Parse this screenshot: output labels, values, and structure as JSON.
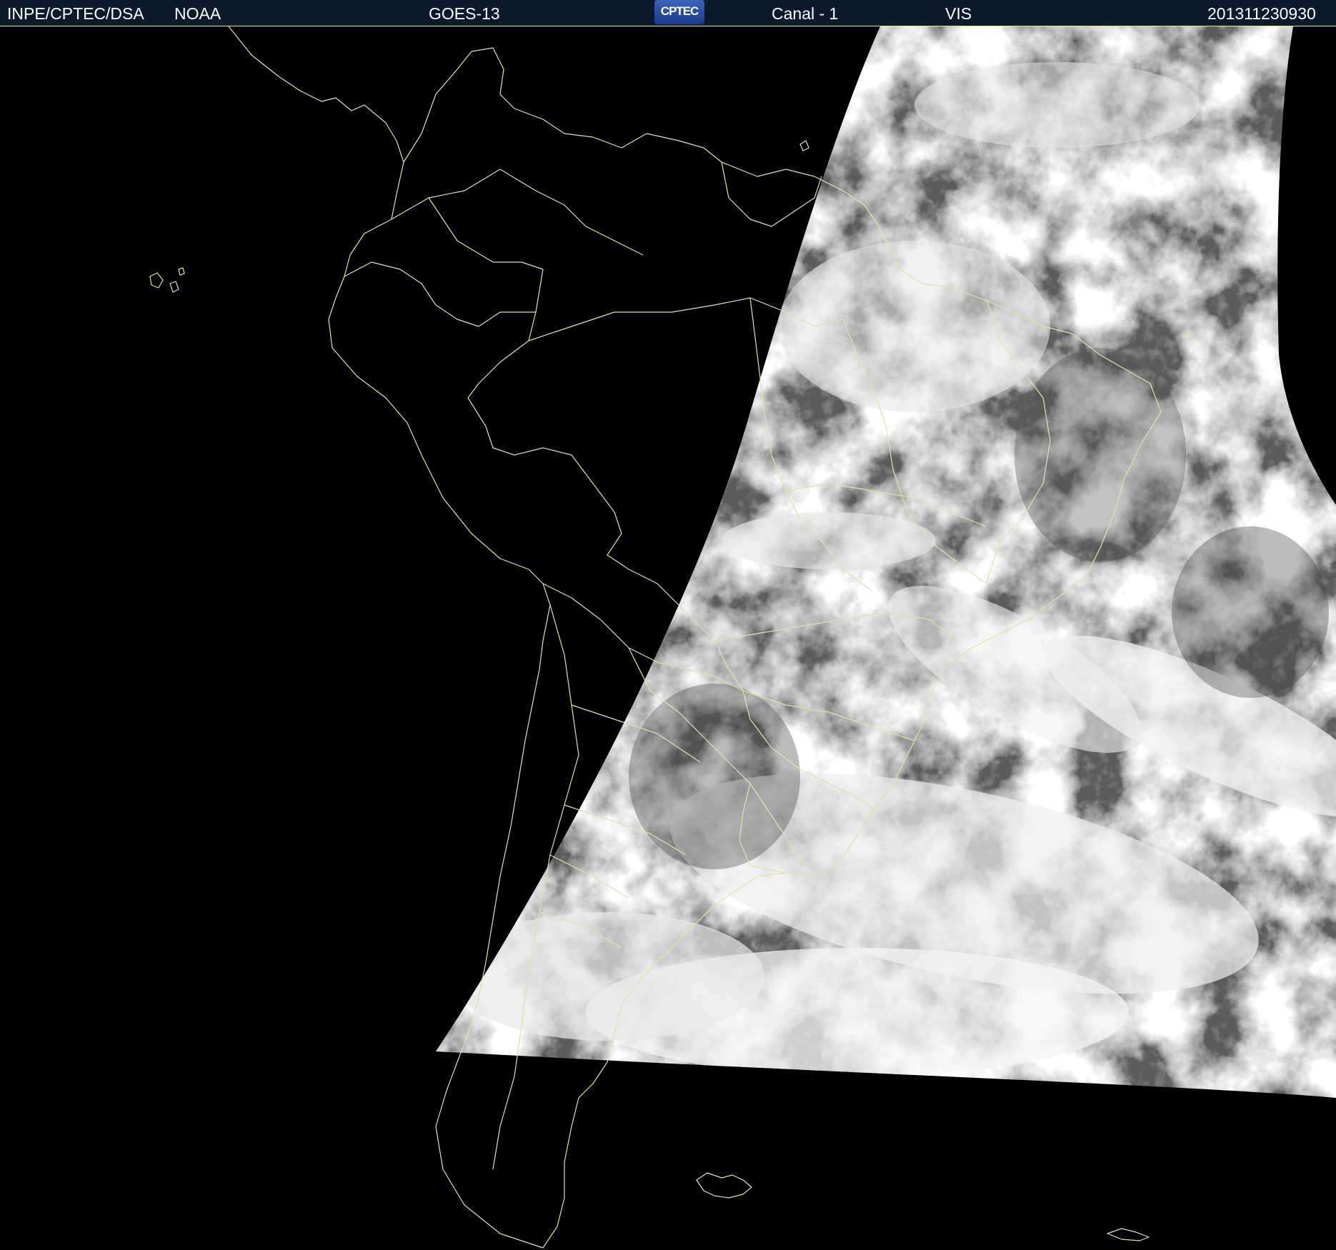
{
  "header": {
    "agency": "INPE/CPTEC/DSA",
    "provider": "NOAA",
    "satellite": "GOES-13",
    "logo_text": "CPTEC",
    "channel": "Canal - 1",
    "band": "VIS",
    "timestamp": "201311230930"
  },
  "colors": {
    "background": "#000000",
    "header_bar": "#0d1a2c",
    "boundaries": "#e5e0a8",
    "logo": "#2a4fa6"
  },
  "icons": {
    "logo": "cptec-logo"
  }
}
